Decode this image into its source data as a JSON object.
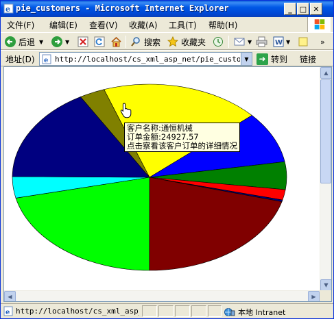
{
  "window": {
    "title": "pie_customers - Microsoft Internet Explorer",
    "minimize": "_",
    "maximize": "□",
    "close": "✕"
  },
  "menu": {
    "items": [
      "文件(F)",
      "编辑(E)",
      "查看(V)",
      "收藏(A)",
      "工具(T)",
      "帮助(H)"
    ]
  },
  "toolbar": {
    "back_label": "后退",
    "search_label": "搜索",
    "favorites_label": "收藏夹"
  },
  "address": {
    "label": "地址(D)",
    "url": "http://localhost/cs_xml_asp_net/pie_customers.",
    "go_label": "转到",
    "links_label": "链接"
  },
  "tooltip": {
    "line1": "客户名称:通恒机械",
    "line2": "订单金额:24927.57",
    "line3": "点击察看该客户订单的详细情况"
  },
  "status": {
    "url": "http://localhost/cs_xml_asp_ne",
    "zone": "本地 Intranet"
  },
  "colors": {
    "titlebar": "#0054e3",
    "slice_yellow": "#ffff00",
    "slice_blue": "#0000ff",
    "slice_green": "#008000",
    "slice_red": "#ff0000",
    "slice_maroon": "#800000",
    "slice_lime": "#00ff00",
    "slice_cyan": "#00ffff",
    "slice_navy": "#000080",
    "slice_olive": "#808000"
  },
  "chart_data": {
    "type": "pie",
    "slices": [
      {
        "color": "#ffff00",
        "fraction": 0.188
      },
      {
        "color": "#0000ff",
        "fraction": 0.089
      },
      {
        "color": "#008000",
        "fraction": 0.048
      },
      {
        "color": "#ff0000",
        "fraction": 0.018
      },
      {
        "color": "#000080",
        "fraction": 0.003
      },
      {
        "color": "#800000",
        "fraction": 0.208
      },
      {
        "color": "#00ff00",
        "fraction": 0.214
      },
      {
        "color": "#00ffff",
        "fraction": 0.037
      },
      {
        "color": "#000080",
        "fraction": 0.165
      },
      {
        "color": "#808000",
        "fraction": 0.03
      }
    ],
    "highlighted_customer": "通恒机械",
    "highlighted_amount": 24927.57
  }
}
